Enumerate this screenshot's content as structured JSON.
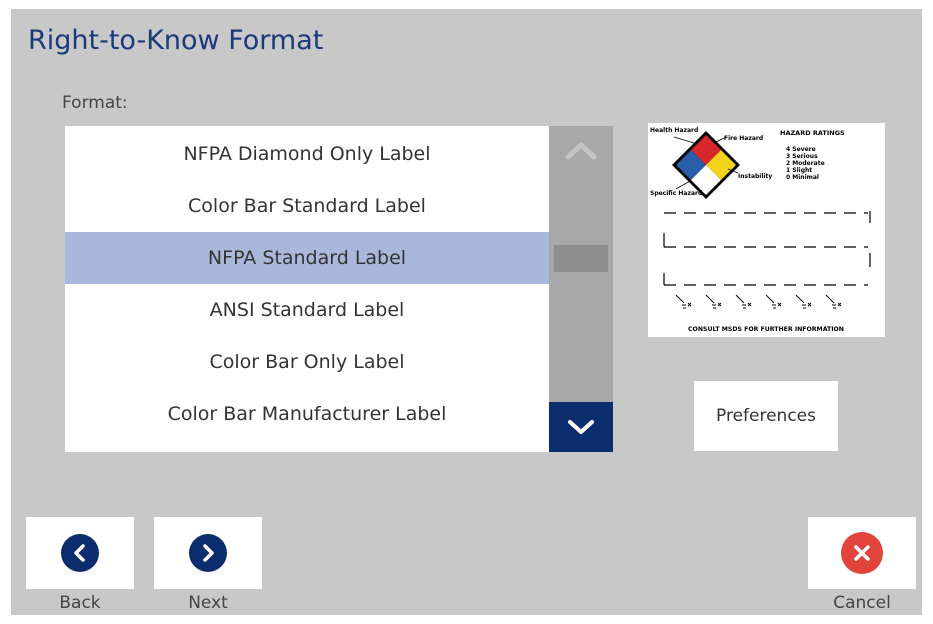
{
  "title": "Right-to-Know Format",
  "format_label": "Format:",
  "formats": [
    "NFPA Diamond Only Label",
    "Color Bar Standard Label",
    "NFPA Standard Label",
    "ANSI Standard Label",
    "Color Bar Only Label",
    "Color Bar Manufacturer Label"
  ],
  "selected_format": "NFPA Standard Label",
  "preview": {
    "health_hazard": "Health Hazard",
    "fire_hazard": "Fire Hazard",
    "hazard_ratings_title": "HAZARD RATINGS",
    "ratings": [
      "4 Severe",
      "3 Serious",
      "2 Moderate",
      "1 Slight",
      "0 Minimal"
    ],
    "instability": "Instability",
    "specific_hazard": "Specific Hazard",
    "footer": "CONSULT MSDS FOR FURTHER INFORMATION"
  },
  "preferences_label": "Preferences",
  "back_label": "Back",
  "next_label": "Next",
  "cancel_label": "Cancel",
  "colors": {
    "title": "#1a3a7a",
    "nav_circle": "#0b2d6e",
    "cancel_circle": "#e0443a",
    "selected_row": "#a9b7da"
  }
}
